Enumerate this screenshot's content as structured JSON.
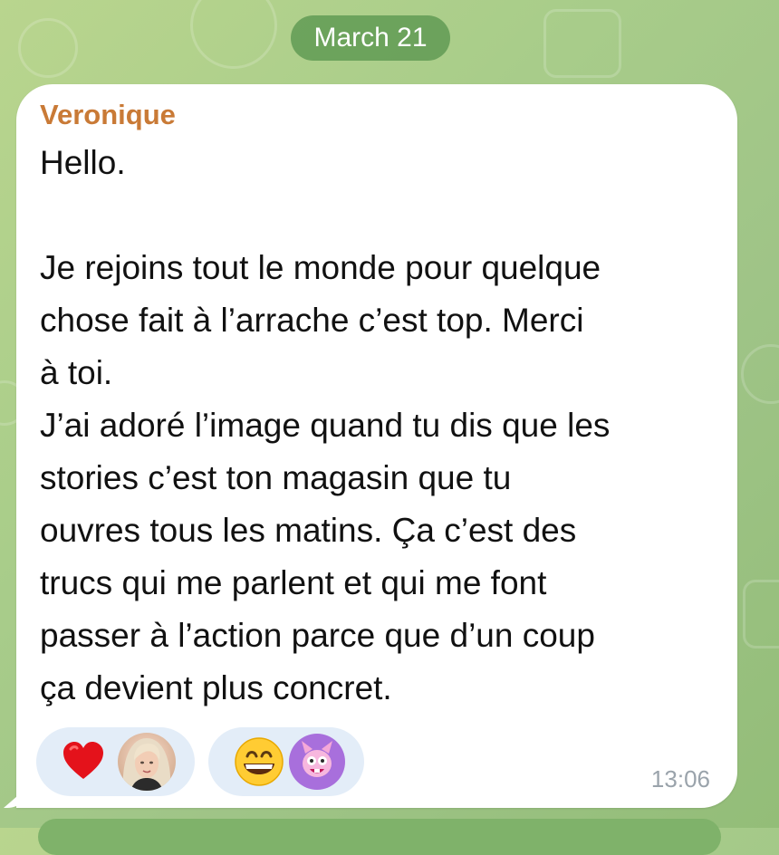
{
  "date_separator": "March 21",
  "message": {
    "sender": "Veronique",
    "lines_block1": [
      "Hello."
    ],
    "lines_block2": [
      "Je rejoins tout le monde pour quelque",
      "chose fait à l’arrache c’est top. Merci",
      "à toi.",
      "J’ai adoré l’image quand tu dis que les",
      "stories c’est ton magasin que tu",
      "ouvres tous les matins. Ça c’est des",
      "trucs qui me parlent et qui me font",
      "passer à l’action parce que d’un coup",
      "ça devient plus concret."
    ],
    "time": "13:06"
  },
  "reactions": [
    {
      "emoji_icon": "red-heart-icon",
      "reactor": "user-avatar"
    },
    {
      "emoji_icon": "grinning-face-icon",
      "reactor": "sticker-avatar"
    }
  ],
  "colors": {
    "sender_name": "#c97a36",
    "reaction_pill": "#e3edf8",
    "date_pill": "#5a9650",
    "background": "#a9cd8a"
  }
}
